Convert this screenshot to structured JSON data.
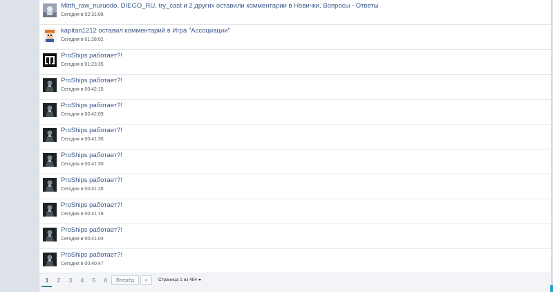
{
  "feed": [
    {
      "avatar": "photo",
      "title": "Mitth_raw_nuruodo, DIEGO_RU, try_cast и 2 других оставили комментарии в Новички. Вопросы - Ответы",
      "time": "Сегодня в 02:31:08"
    },
    {
      "avatar": "cartoon",
      "title": "kapitan1212 оставил комментарий в Игра \"Ассоциации\"",
      "time": "Сегодня в 01:28:02"
    },
    {
      "avatar": "logo",
      "title": "ProShips работает?!",
      "time": "Сегодня в 01:23:35"
    },
    {
      "avatar": "dark",
      "title": "ProShips работает?!",
      "time": "Сегодня в 00:42:15"
    },
    {
      "avatar": "dark",
      "title": "ProShips работает?!",
      "time": "Сегодня в 00:42:09"
    },
    {
      "avatar": "dark",
      "title": "ProShips работает?!",
      "time": "Сегодня в 00:41:36"
    },
    {
      "avatar": "dark",
      "title": "ProShips работает?!",
      "time": "Сегодня в 00:41:30"
    },
    {
      "avatar": "dark",
      "title": "ProShips работает?!",
      "time": "Сегодня в 00:41:26"
    },
    {
      "avatar": "dark",
      "title": "ProShips работает?!",
      "time": "Сегодня в 00:41:19"
    },
    {
      "avatar": "dark",
      "title": "ProShips работает?!",
      "time": "Сегодня в 00:41:04"
    },
    {
      "avatar": "dark",
      "title": "ProShips работает?!",
      "time": "Сегодня в 00:40:47"
    }
  ],
  "pagination": {
    "pages": [
      "1",
      "2",
      "3",
      "4",
      "5",
      "6"
    ],
    "current": "1",
    "next_label": "Вперёд",
    "last_label": "»",
    "page_info": "Страница 1 из 484",
    "icons": {
      "dropdown": "chevron-down-icon"
    }
  },
  "colors": {
    "link": "#3d5a8a",
    "accent": "#2f7c98"
  }
}
